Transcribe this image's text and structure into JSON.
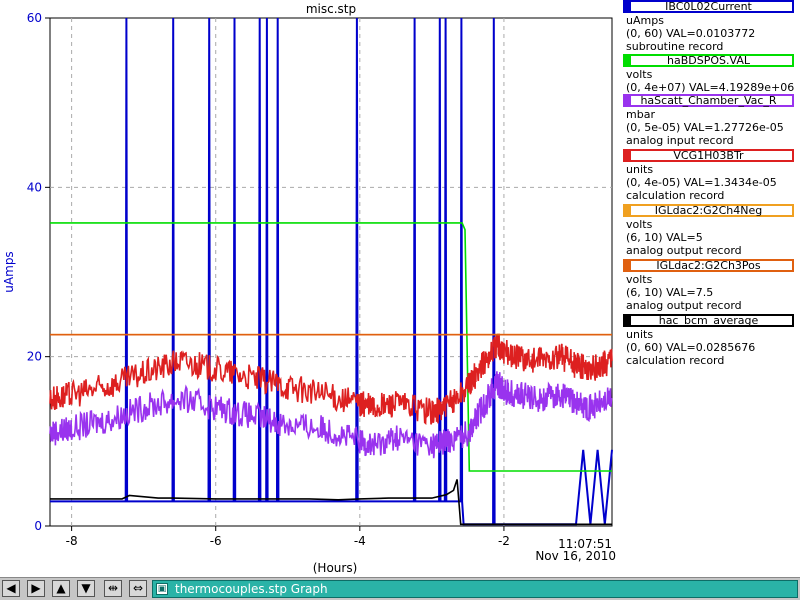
{
  "chart_data": {
    "type": "line",
    "title": "misc.stp",
    "xlabel": "(Hours)",
    "ylabel": "uAmps",
    "xlim": [
      -8.3,
      -0.5
    ],
    "ylim": [
      0,
      60
    ],
    "x_ticks": [
      -8,
      -6,
      -4,
      -2
    ],
    "y_ticks": [
      0,
      20,
      40,
      60
    ],
    "x_tick_labels": [
      "-8",
      "-6",
      "-4",
      "-2"
    ],
    "y_tick_labels": [
      "0",
      "20",
      "40",
      "60"
    ],
    "timestamp": {
      "time": "11:07:51",
      "date": "Nov 16, 2010"
    },
    "grid": true,
    "series": [
      {
        "name": "IBC0L02Current",
        "color": "#0000cc",
        "x": [
          -8.3,
          -7.25,
          -7.24,
          -7.23,
          -6.6,
          -6.59,
          -6.58,
          -6.1,
          -6.09,
          -6.08,
          -5.75,
          -5.74,
          -5.73,
          -5.4,
          -5.39,
          -5.38,
          -5.3,
          -5.29,
          -5.28,
          -5.15,
          -5.14,
          -5.13,
          -4.05,
          -4.04,
          -4.03,
          -3.25,
          -3.24,
          -3.23,
          -2.9,
          -2.89,
          -2.88,
          -2.82,
          -2.81,
          -2.8,
          -2.6,
          -2.59,
          -2.58,
          -2.56,
          -2.55,
          -2.15,
          -2.14,
          -2.13,
          -1.9,
          -1.0,
          -0.9,
          -0.8,
          -0.7,
          -0.6,
          -0.5
        ],
        "y": [
          2.9,
          2.9,
          60,
          2.9,
          2.9,
          60,
          2.9,
          2.9,
          60,
          2.9,
          2.9,
          60,
          2.9,
          2.9,
          60,
          2.9,
          2.9,
          60,
          2.9,
          2.9,
          60,
          2.9,
          2.9,
          60,
          2.9,
          2.9,
          60,
          2.9,
          2.9,
          60,
          2.9,
          2.9,
          60,
          2.9,
          2.9,
          60,
          2.9,
          0.2,
          0.2,
          0.2,
          60,
          0.2,
          0.2,
          0.2,
          9,
          0.2,
          9,
          0.2,
          9
        ]
      },
      {
        "name": "haBDSPOS.VAL",
        "color": "#00dd00",
        "x": [
          -8.3,
          -2.58,
          -2.54,
          -2.48,
          -0.5
        ],
        "y": [
          35.8,
          35.8,
          35.0,
          6.5,
          6.5
        ]
      },
      {
        "name": "haScatt_Chamber_Vac_R",
        "color": "#9933ee",
        "x": [
          -8.3,
          -8.0,
          -7.5,
          -7.0,
          -6.5,
          -6.0,
          -5.5,
          -5.0,
          -4.5,
          -4.0,
          -3.8,
          -3.5,
          -3.0,
          -2.8,
          -2.5,
          -2.3,
          -2.1,
          -2.0,
          -1.8,
          -1.5,
          -1.2,
          -1.0,
          -0.8,
          -0.5
        ],
        "y": [
          11,
          11.5,
          12.5,
          14,
          15,
          14,
          13,
          12,
          11.5,
          10,
          9.5,
          10.5,
          9.5,
          10,
          11,
          14,
          17,
          16,
          15.5,
          15,
          15.5,
          14.5,
          14,
          15
        ]
      },
      {
        "name": "VCG1H03BTr",
        "color": "#dd2020",
        "x": [
          -8.3,
          -8.0,
          -7.5,
          -7.0,
          -6.5,
          -6.0,
          -5.5,
          -5.0,
          -4.5,
          -4.0,
          -3.8,
          -3.5,
          -3.0,
          -2.8,
          -2.5,
          -2.3,
          -2.1,
          -2.0,
          -1.8,
          -1.5,
          -1.2,
          -1.0,
          -0.8,
          -0.5
        ],
        "y": [
          15,
          15.5,
          16.5,
          18,
          19.5,
          18.5,
          17.5,
          16.5,
          15.5,
          14.5,
          14,
          14.5,
          13.5,
          14,
          16.5,
          19,
          21.5,
          20.5,
          20,
          19.5,
          20,
          19,
          18.5,
          19.5
        ]
      },
      {
        "name": "IGLdac2:G2Ch4Neg",
        "color": "#f0a020",
        "x": [
          -8.3,
          -0.5
        ],
        "y": [
          22.6,
          22.6
        ]
      },
      {
        "name": "IGLdac2:G2Ch3Pos",
        "color": "#e06010",
        "x": [
          -8.3,
          -0.5
        ],
        "y": [
          22.6,
          22.6
        ]
      },
      {
        "name": "hac_bcm_average",
        "color": "#000000",
        "x": [
          -8.3,
          -7.3,
          -7.2,
          -6.8,
          -6.6,
          -6.0,
          -5.8,
          -4.7,
          -4.3,
          -4.0,
          -3.6,
          -3.3,
          -3.0,
          -2.8,
          -2.7,
          -2.65,
          -2.6,
          -2.5,
          -2.4,
          -1.0,
          -0.5
        ],
        "y": [
          3.2,
          3.2,
          3.6,
          3.3,
          3.3,
          3.2,
          3.2,
          3.2,
          3.1,
          3.2,
          3.3,
          3.3,
          3.3,
          3.7,
          4.2,
          5.5,
          0.2,
          0.2,
          0.2,
          0.2,
          0.2
        ]
      }
    ]
  },
  "legend": {
    "entries": [
      {
        "name": "IBC0L02Current",
        "color": "#0000cc",
        "line1": "uAmps",
        "line2": "(0, 60) VAL=0.0103772",
        "line3": "subroutine record"
      },
      {
        "name": "haBDSPOS.VAL",
        "color": "#00dd00",
        "line1": "volts",
        "line2": "(0, 4e+07) VAL=4.19289e+06",
        "line3": ""
      },
      {
        "name": "haScatt_Chamber_Vac_R",
        "color": "#9933ee",
        "line1": "mbar",
        "line2": "(0, 5e-05) VAL=1.27726e-05",
        "line3": "analog input record"
      },
      {
        "name": "VCG1H03BTr",
        "color": "#dd2020",
        "line1": "units",
        "line2": "(0, 4e-05) VAL=1.3434e-05",
        "line3": "calculation record"
      },
      {
        "name": "IGLdac2:G2Ch4Neg",
        "color": "#f0a020",
        "line1": "volts",
        "line2": "(6, 10) VAL=5",
        "line3": "analog output record"
      },
      {
        "name": "IGLdac2:G2Ch3Pos",
        "color": "#e06010",
        "line1": "volts",
        "line2": "(6, 10) VAL=7.5",
        "line3": "analog output record"
      },
      {
        "name": "hac_bcm_average",
        "color": "#000000",
        "line1": "units",
        "line2": "(0, 60) VAL=0.0285676",
        "line3": "calculation record"
      }
    ]
  },
  "taskbar": {
    "buttons": [
      {
        "icon": "arrow-left-icon",
        "glyph": "◀"
      },
      {
        "icon": "arrow-right-icon",
        "glyph": "▶"
      },
      {
        "icon": "arrow-up-icon",
        "glyph": "▲"
      },
      {
        "icon": "arrow-down-icon",
        "glyph": "▼"
      },
      {
        "icon": "expand-icon",
        "glyph": "⇹"
      },
      {
        "icon": "compress-icon",
        "glyph": "⇔"
      }
    ],
    "window_label": "thermocouples.stp Graph"
  }
}
